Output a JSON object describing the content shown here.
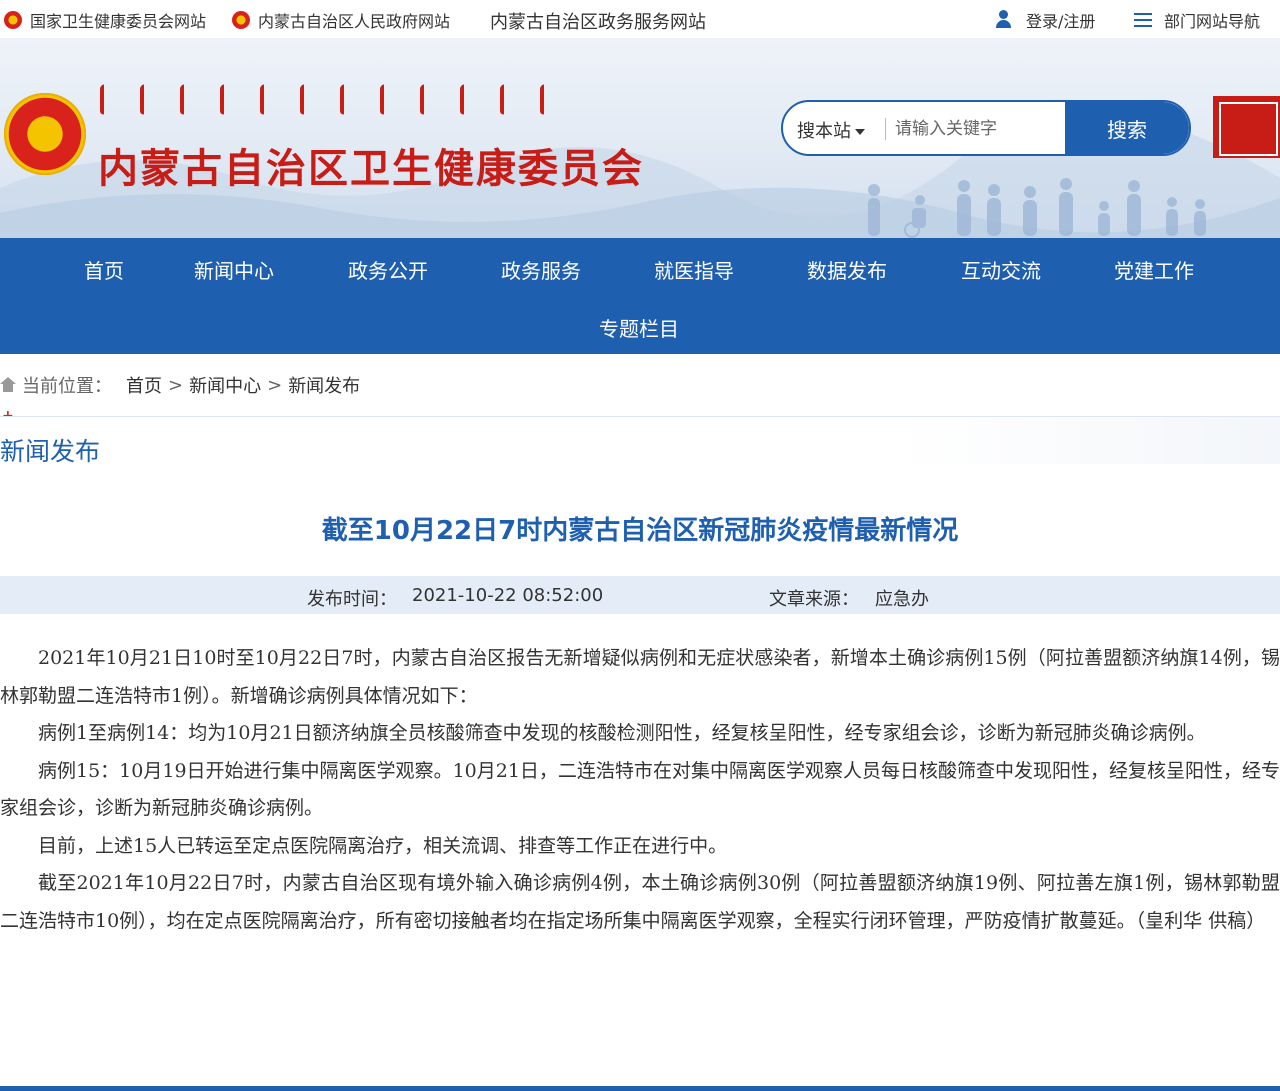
{
  "topbar": {
    "link1": "国家卫生健康委员会网站",
    "link2": "内蒙古自治区人民政府网站",
    "link3": "内蒙古自治区政务服务网站",
    "login": "登录/注册",
    "dept_nav": "部门网站导航"
  },
  "header": {
    "site_title": "内蒙古自治区卫生健康委员会",
    "search_scope": "搜本站",
    "search_placeholder": "请输入关键字",
    "search_button": "搜索"
  },
  "nav": {
    "items": [
      "首页",
      "新闻中心",
      "政务公开",
      "政务服务",
      "就医指导",
      "数据发布",
      "互动交流",
      "党建工作",
      "专题栏目"
    ]
  },
  "breadcrumb": {
    "label": "当前位置：",
    "items": [
      "首页",
      "新闻中心",
      "新闻发布"
    ],
    "separator": ">"
  },
  "section": {
    "title": "新闻发布",
    "marker": "+"
  },
  "article": {
    "title": "截至10月22日7时内蒙古自治区新冠肺炎疫情最新情况",
    "publish_label": "发布时间：",
    "publish_time": "2021-10-22 08:52:00",
    "source_label": "文章来源：",
    "source": "应急办",
    "paragraphs": [
      "2021年10月21日10时至10月22日7时，内蒙古自治区报告无新增疑似病例和无症状感染者，新增本土确诊病例15例（阿拉善盟额济纳旗14例，锡林郭勒盟二连浩特市1例）。新增确诊病例具体情况如下：",
      "病例1至病例14：均为10月21日额济纳旗全员核酸筛查中发现的核酸检测阳性，经复核呈阳性，经专家组会诊，诊断为新冠肺炎确诊病例。",
      "病例15：10月19日开始进行集中隔离医学观察。10月21日，二连浩特市在对集中隔离医学观察人员每日核酸筛查中发现阳性，经复核呈阳性，经专家组会诊，诊断为新冠肺炎确诊病例。",
      "目前，上述15人已转运至定点医院隔离治疗，相关流调、排查等工作正在进行中。",
      "截至2021年10月22日7时，内蒙古自治区现有境外输入确诊病例4例，本土确诊病例30例（阿拉善盟额济纳旗19例、阿拉善左旗1例，锡林郭勒盟二连浩特市10例），均在定点医院隔离治疗，所有密切接触者均在指定场所集中隔离医学观察，全程实行闭环管理，严防疫情扩散蔓延。（皇利华 供稿）"
    ]
  },
  "colors": {
    "primary": "#1f5fb0",
    "accent": "#c81d17",
    "meta_bg": "#e4edf7"
  }
}
